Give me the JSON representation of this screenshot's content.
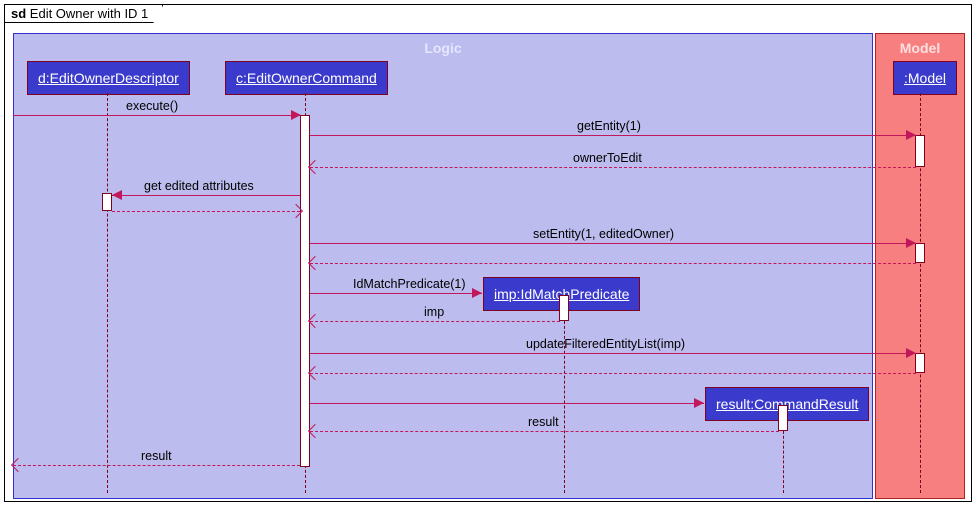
{
  "frame": {
    "sd_prefix": "sd",
    "title": "Edit Owner with ID 1"
  },
  "regions": {
    "logic": "Logic",
    "model": "Model"
  },
  "participants": {
    "d": "d:EditOwnerDescriptor",
    "c": "c:EditOwnerCommand",
    "imp": "imp:IdMatchPredicate",
    "result": "result:CommandResult",
    "model": ":Model"
  },
  "messages": {
    "execute": "execute()",
    "getEntity": "getEntity(1)",
    "ownerToEdit": "ownerToEdit",
    "getEdited": "get edited attributes",
    "setEntity": "setEntity(1, editedOwner)",
    "idMatchPredicate": "IdMatchPredicate(1)",
    "impReturn": "imp",
    "updateFiltered": "updateFilteredEntityList(imp)",
    "resultReturn": "result",
    "resultFinal": "result"
  },
  "chart_data": {
    "type": "sequence-diagram",
    "title": "Edit Owner with ID 1",
    "regions": [
      {
        "name": "Logic",
        "participants": [
          "d:EditOwnerDescriptor",
          "c:EditOwnerCommand",
          "imp:IdMatchPredicate",
          "result:CommandResult"
        ]
      },
      {
        "name": "Model",
        "participants": [
          ":Model"
        ]
      }
    ],
    "lifelines": [
      "(caller)",
      "d:EditOwnerDescriptor",
      "c:EditOwnerCommand",
      "imp:IdMatchPredicate",
      "result:CommandResult",
      ":Model"
    ],
    "messages": [
      {
        "from": "(caller)",
        "to": "c:EditOwnerCommand",
        "label": "execute()",
        "type": "sync"
      },
      {
        "from": "c:EditOwnerCommand",
        "to": ":Model",
        "label": "getEntity(1)",
        "type": "sync"
      },
      {
        "from": ":Model",
        "to": "c:EditOwnerCommand",
        "label": "ownerToEdit",
        "type": "return"
      },
      {
        "from": "c:EditOwnerCommand",
        "to": "d:EditOwnerDescriptor",
        "label": "get edited attributes",
        "type": "sync"
      },
      {
        "from": "d:EditOwnerDescriptor",
        "to": "c:EditOwnerCommand",
        "label": "",
        "type": "return"
      },
      {
        "from": "c:EditOwnerCommand",
        "to": ":Model",
        "label": "setEntity(1, editedOwner)",
        "type": "sync"
      },
      {
        "from": ":Model",
        "to": "c:EditOwnerCommand",
        "label": "",
        "type": "return"
      },
      {
        "from": "c:EditOwnerCommand",
        "to": "imp:IdMatchPredicate",
        "label": "IdMatchPredicate(1)",
        "type": "create"
      },
      {
        "from": "imp:IdMatchPredicate",
        "to": "c:EditOwnerCommand",
        "label": "imp",
        "type": "return"
      },
      {
        "from": "c:EditOwnerCommand",
        "to": ":Model",
        "label": "updateFilteredEntityList(imp)",
        "type": "sync"
      },
      {
        "from": ":Model",
        "to": "c:EditOwnerCommand",
        "label": "",
        "type": "return"
      },
      {
        "from": "c:EditOwnerCommand",
        "to": "result:CommandResult",
        "label": "",
        "type": "create"
      },
      {
        "from": "result:CommandResult",
        "to": "c:EditOwnerCommand",
        "label": "result",
        "type": "return"
      },
      {
        "from": "c:EditOwnerCommand",
        "to": "(caller)",
        "label": "result",
        "type": "return"
      }
    ]
  }
}
